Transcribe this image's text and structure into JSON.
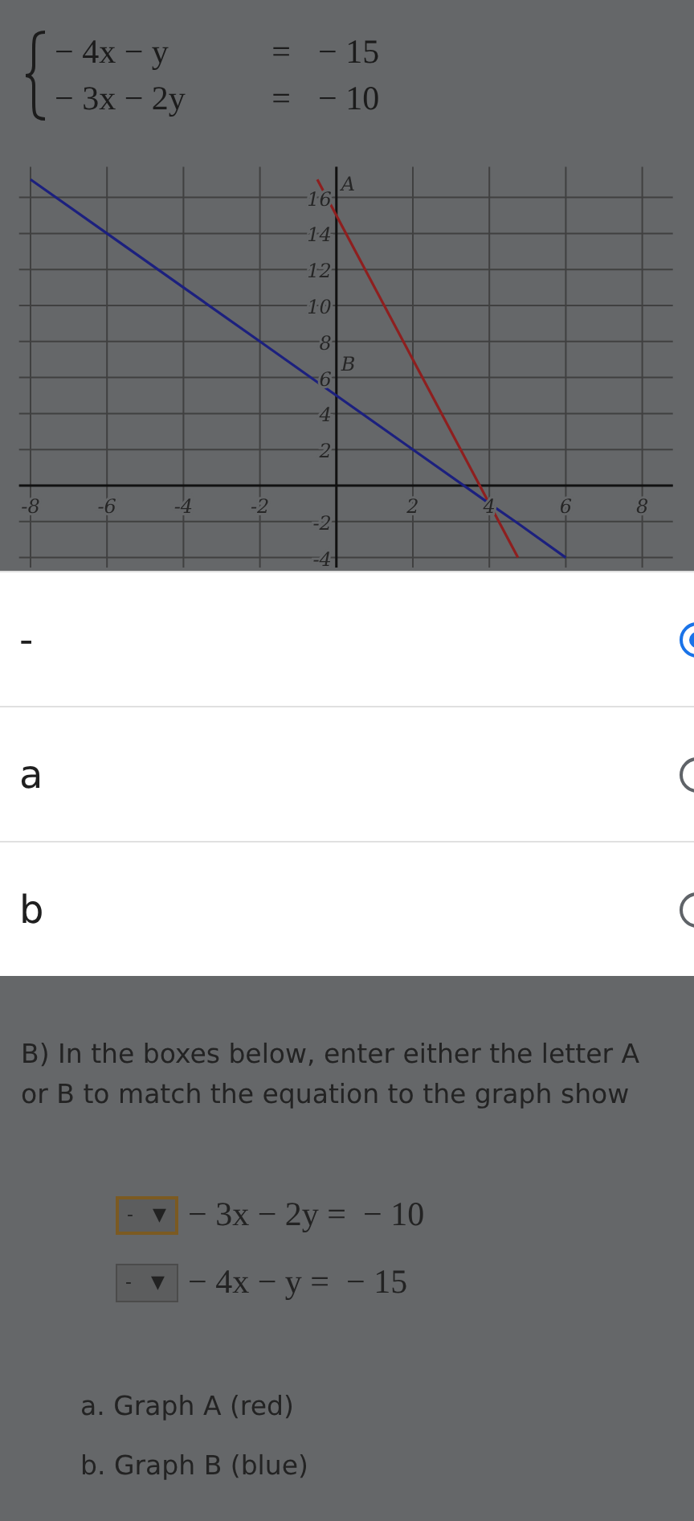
{
  "system": {
    "equations": [
      {
        "lhs": "− 4x − y",
        "relation": "=",
        "rhs": "− 15"
      },
      {
        "lhs": "− 3x − 2y",
        "relation": "=",
        "rhs": "− 10"
      }
    ]
  },
  "graph": {
    "chart_data": {
      "type": "line",
      "grid": true,
      "x": [
        -8,
        -6,
        -4,
        -2,
        -0.5,
        0,
        2,
        4,
        4.75,
        6
      ],
      "series": [
        {
          "name": "A",
          "color": "#8e1f1f",
          "values": [
            null,
            null,
            null,
            null,
            17,
            15,
            7,
            -1,
            -4,
            null
          ]
        },
        {
          "name": "B",
          "color": "#1c207e",
          "values": [
            17,
            14,
            11,
            8,
            5.75,
            5,
            2,
            -1,
            -2.1,
            -4
          ]
        }
      ],
      "xlim": [
        -8.3,
        8.8
      ],
      "ylim": [
        -4.5,
        17.7
      ],
      "xticks": [
        -8,
        -6,
        -4,
        -2,
        2,
        4,
        6,
        8
      ],
      "yticks": [
        16,
        14,
        12,
        10,
        8,
        6,
        4,
        2,
        -2,
        -4
      ]
    }
  },
  "part_b": {
    "prompt_lines": [
      "B) In the boxes below, enter either the letter A",
      "or B to match the equation to the graph show"
    ],
    "matches": [
      {
        "value": "-",
        "arrow": "▼",
        "focused": true,
        "equation": "− 3x − 2y =  − 10"
      },
      {
        "value": "-",
        "arrow": "▼",
        "focused": false,
        "equation": "− 4x − y =  − 15"
      }
    ],
    "choices": [
      "a. Graph A (red)",
      "b. Graph B (blue)"
    ]
  },
  "picker": {
    "options": [
      {
        "label": "-",
        "selected": true
      },
      {
        "label": "a",
        "selected": false
      },
      {
        "label": "b",
        "selected": false
      }
    ]
  }
}
